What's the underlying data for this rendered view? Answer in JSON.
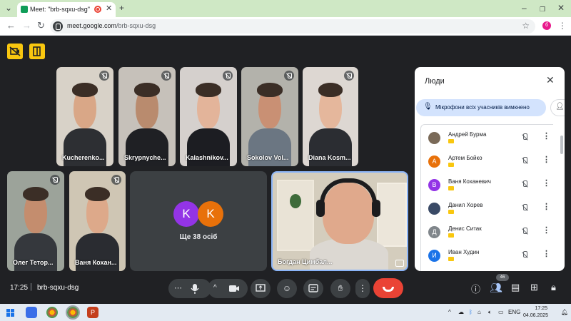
{
  "browser": {
    "tab_title": "Meet: \"brb-sqxu-dsg\"",
    "url_host": "meet.google.com",
    "url_path": "/brb-sqxu-dsg",
    "profile_initial": "б"
  },
  "tiles_top": [
    {
      "name": "Kucherenko...",
      "bg": "#d8d2c8",
      "skin": "#d9a787",
      "shirt": "#2d2f33"
    },
    {
      "name": "Skrypnyche...",
      "bg": "#c6c1ba",
      "skin": "#b98b6e",
      "shirt": "#1f2024"
    },
    {
      "name": "Kalashnikov...",
      "bg": "#d5d0cd",
      "skin": "#e3b49a",
      "shirt": "#1c1d22"
    },
    {
      "name": "Sokolov Vol...",
      "bg": "#b3b2ab",
      "skin": "#c99074",
      "shirt": "#6b7682"
    },
    {
      "name": "Diana Kosm...",
      "bg": "#ddd7d2",
      "skin": "#e5b79c",
      "shirt": "#2b2d32"
    }
  ],
  "tiles_bottom": [
    {
      "name": "Олег Тетор...",
      "bg": "#9ca39a",
      "skin": "#c48d6e",
      "shirt": "#35383d"
    },
    {
      "name": "Ваня Кохан...",
      "bg": "#cfc6b4",
      "skin": "#dda98a",
      "shirt": "#2a2c31"
    }
  ],
  "more_tile": {
    "label": "Ще 38 осіб",
    "avatars": [
      {
        "letter": "K",
        "color": "#9334e6"
      },
      {
        "letter": "K",
        "color": "#e8710a"
      }
    ]
  },
  "self_tile": {
    "name": "Богдан Цимбал..."
  },
  "panel": {
    "title": "Люди",
    "mute_all_label": "Мікрофони всіх учасників вимкнено",
    "people": [
      {
        "name": "Андрей Бурма",
        "initial": "",
        "color": "#7a6a58"
      },
      {
        "name": "Артем Бойко",
        "initial": "А",
        "color": "#e8710a"
      },
      {
        "name": "Ваня Коханевич",
        "initial": "В",
        "color": "#9334e6"
      },
      {
        "name": "Данил Хорев",
        "initial": "",
        "color": "#3a4a66"
      },
      {
        "name": "Денис Ситак",
        "initial": "Д",
        "color": "#80868b"
      },
      {
        "name": "Иван Худин",
        "initial": "И",
        "color": "#1a73e8"
      }
    ]
  },
  "toolbar": {
    "time": "17:25",
    "separator": "|",
    "code": "brb-sqxu-dsg",
    "people_count": "46"
  },
  "taskbar": {
    "lang": "ENG",
    "time": "17:25",
    "date": "04.06.2025"
  }
}
